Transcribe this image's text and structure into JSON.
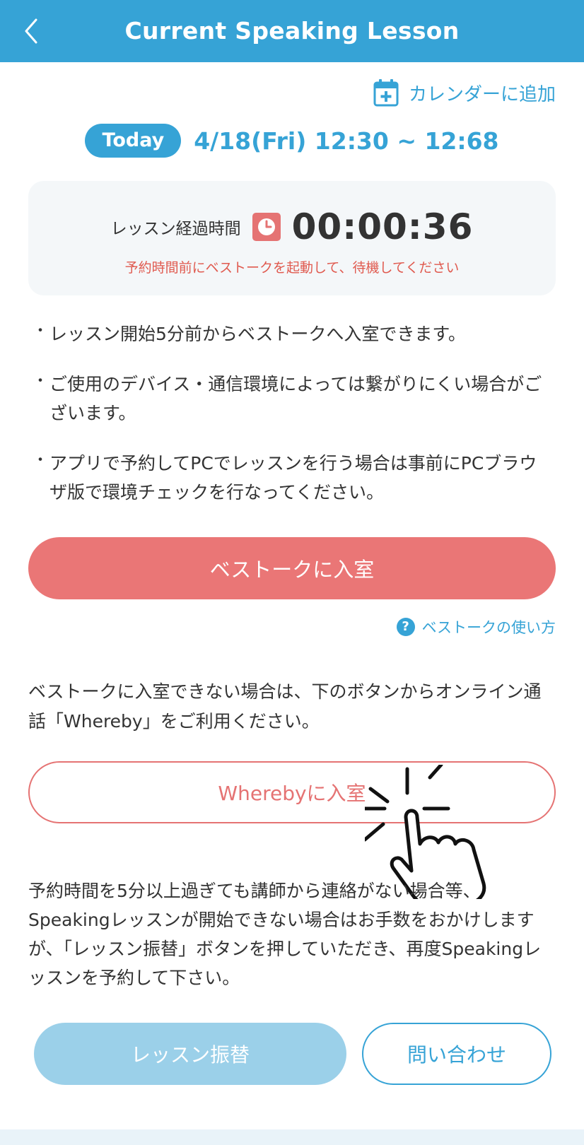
{
  "header": {
    "title": "Current Speaking Lesson",
    "back_icon": "chevron-left-icon"
  },
  "calendar_link": {
    "label": "カレンダーに追加",
    "icon": "calendar-add-icon"
  },
  "lesson": {
    "badge": "Today",
    "datetime": "4/18(Fri) 12:30 ~ 12:68"
  },
  "timer": {
    "label": "レッスン経過時間",
    "icon": "clock-icon",
    "value": "00:00:36",
    "note": "予約時間前にベストークを起動して、待機してください"
  },
  "notes": [
    "レッスン開始5分前からベストークへ入室できます。",
    "ご使用のデバイス・通信環境によっては繋がりにくい場合がございます。",
    "アプリで予約してPCでレッスンを行う場合は事前にPCブラウザ版で環境チェックを行なってください。"
  ],
  "bullet": "・",
  "primary_button": {
    "label": "ベストークに入室"
  },
  "help_link": {
    "icon_text": "?",
    "label": "ベストークの使い方"
  },
  "whereby": {
    "description": "ベストークに入室できない場合は、下のボタンからオンライン通話「Whereby」をご利用ください。",
    "button_label": "Wherebyに入室"
  },
  "bottom_note": "予約時間を5分以上過ぎても講師から連絡がない場合等、Speakingレッスンが開始できない場合はお手数をおかけしますが、「レッスン振替」ボタンを押していただき、再度Speakingレッスンを予約して下さい。",
  "buttons": {
    "reschedule": "レッスン振替",
    "contact": "問い合わせ"
  },
  "colors": {
    "accent": "#36a3d6",
    "primary_button": "#ea7676",
    "warning_text": "#e05a4f",
    "reschedule_button": "#9bd0e9"
  }
}
